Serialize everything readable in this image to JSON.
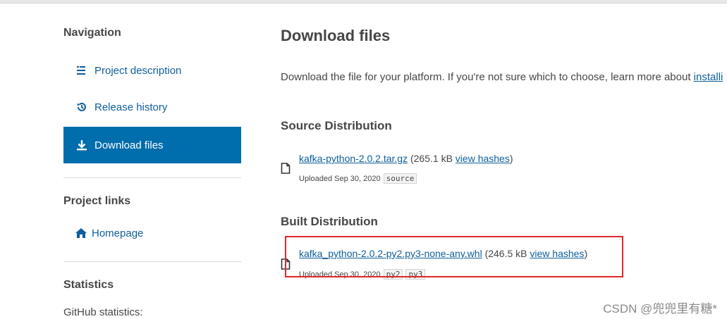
{
  "sidebar": {
    "navigation_heading": "Navigation",
    "nav_items": [
      {
        "label": "Project description",
        "icon": "align-left-icon",
        "active": false
      },
      {
        "label": "Release history",
        "icon": "history-icon",
        "active": false
      },
      {
        "label": "Download files",
        "icon": "download-icon",
        "active": true
      }
    ],
    "project_links_heading": "Project links",
    "homepage_label": "Homepage",
    "statistics_heading": "Statistics",
    "github_statistics_label": "GitHub statistics:"
  },
  "main": {
    "title": "Download files",
    "intro_text": "Download the file for your platform. If you're not sure which to choose, learn more about ",
    "intro_link": "installi",
    "source_section": {
      "title": "Source Distribution",
      "file_name": "kafka-python-2.0.2.tar.gz",
      "size": " (265.1 kB ",
      "hashes_link": "view hashes",
      "close_paren": ")",
      "uploaded": "Uploaded Sep 30, 2020",
      "tags": [
        "source"
      ]
    },
    "built_section": {
      "title": "Built Distribution",
      "file_name": "kafka_python-2.0.2-py2.py3-none-any.whl",
      "size": " (246.5 kB ",
      "hashes_link": "view hashes",
      "close_paren": ")",
      "uploaded": "Uploaded Sep 30, 2020",
      "tags": [
        "py2",
        "py3"
      ]
    }
  },
  "watermark": "CSDN @兜兜里有糖*",
  "colors": {
    "active_nav_bg": "#006dad",
    "link": "#0f5e9c",
    "highlight": "#e0272c"
  }
}
